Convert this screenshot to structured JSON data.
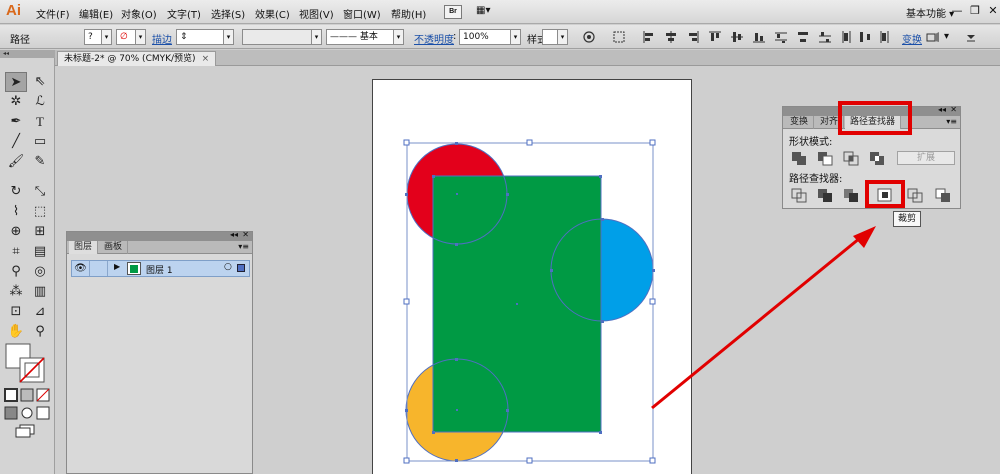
{
  "app": {
    "logo": "Ai"
  },
  "menu": {
    "items": [
      "文件(F)",
      "编辑(E)",
      "对象(O)",
      "文字(T)",
      "选择(S)",
      "效果(C)",
      "视图(V)",
      "窗口(W)",
      "帮助(H)"
    ],
    "bridge": "Br",
    "arrange": "▦▾",
    "workspace": "基本功能 ▾",
    "window_controls": [
      "—",
      "❐",
      "✕"
    ]
  },
  "control": {
    "selection": "路径",
    "fill": "?",
    "stroke_label": "描边",
    "stroke_style": "——— 基本",
    "opacity_label": "不透明度",
    "opacity_value": "100%",
    "style_label": "样式",
    "transform_link": "变换"
  },
  "doc_tab": {
    "title": "未标题-2* @ 70% (CMYK/预览)",
    "close": "×"
  },
  "tools_grip": "◂◂",
  "layers_panel": {
    "tabs": [
      "图层",
      "画板"
    ],
    "layer_name": "图层 1",
    "menu": "▾≡"
  },
  "pathfinder_panel": {
    "tabs": [
      "变换",
      "对齐",
      "路径查找器"
    ],
    "shape_modes_label": "形状模式:",
    "pathfinders_label": "路径查找器:",
    "expand_label": "扩展",
    "menu": "▾≡",
    "tooltip": "裁剪"
  },
  "colors": {
    "red_circle": "#e3001b",
    "blue_circle": "#009fe8",
    "yellow_circle": "#f7b52c",
    "green_rect": "#009a44",
    "selection": "#4f6fc2",
    "annotation": "#e10000"
  },
  "icons": [
    "selection-tool-icon",
    "direct-select-icon",
    "magic-wand-icon",
    "lasso-icon",
    "pen-icon",
    "type-icon",
    "line-icon",
    "rectangle-icon",
    "paintbrush-icon",
    "pencil-icon",
    "rotate-icon",
    "scale-icon",
    "warp-icon",
    "free-transform-icon",
    "shape-builder-icon",
    "perspective-icon",
    "mesh-icon",
    "gradient-icon",
    "eyedropper-icon",
    "blend-icon",
    "symbol-sprayer-icon",
    "graph-icon",
    "artboard-icon",
    "slice-icon",
    "hand-icon",
    "zoom-icon",
    "eye-icon",
    "lock-icon"
  ]
}
